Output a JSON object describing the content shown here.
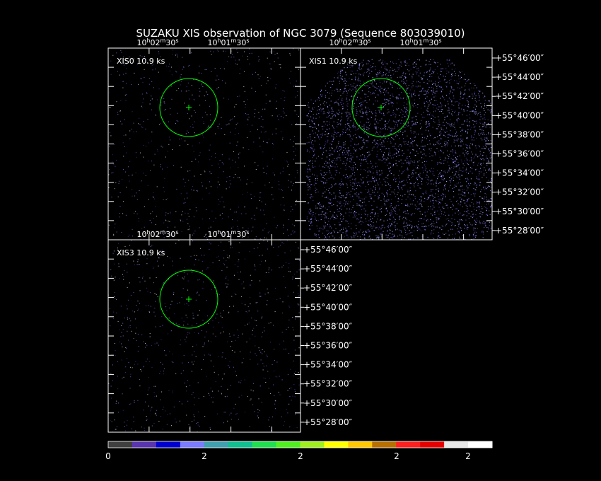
{
  "title": "SUZAKU XIS observation of NGC 3079  (Sequence 803039010)",
  "panels": [
    {
      "id": "xis0",
      "label": "XIS0 10.9 ks",
      "ra_ticks": [
        "10h02m30s",
        "10h01m30s"
      ],
      "dec_ticks": []
    },
    {
      "id": "xis1",
      "label": "XIS1 10.9 ks",
      "ra_ticks": [
        "10h02m30s",
        "10h01m30s"
      ],
      "dec_ticks": [
        "+55°46′00″",
        "+55°44′00″",
        "+55°42′00″",
        "+55°40′00″",
        "+55°38′00″",
        "+55°36′00″",
        "+55°34′00″",
        "+55°32′00″",
        "+55°30′00″",
        "+55°28′00″"
      ]
    },
    {
      "id": "xis3",
      "label": "XIS3 10.9 ks",
      "ra_ticks": [
        "10h02m30s",
        "10h01m30s"
      ],
      "dec_ticks": [
        "+55°46′00″",
        "+55°44′00″",
        "+55°42′00″",
        "+55°40′00″",
        "+55°38′00″",
        "+55°36′00″",
        "+55°34′00″",
        "+55°32′00″",
        "+55°30′00″",
        "+55°28′00″"
      ]
    }
  ],
  "colorbar": {
    "colors": [
      "#404040",
      "#5a35b0",
      "#0000d0",
      "#7c7cff",
      "#40a0b0",
      "#10c090",
      "#20e050",
      "#50f020",
      "#a0f020",
      "#ffff00",
      "#ffc800",
      "#b87000",
      "#ff2020",
      "#e80000",
      "#e8e8e8",
      "#ffffff"
    ],
    "labels": [
      "0",
      "2",
      "2",
      "2",
      "2"
    ]
  },
  "colors": {
    "background": "#000000",
    "frame": "#ffffff",
    "region": "#00ff00"
  }
}
